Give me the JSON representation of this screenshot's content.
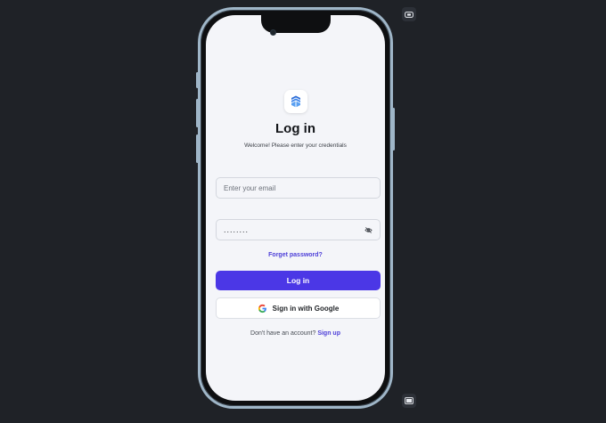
{
  "login": {
    "title": "Log in",
    "subtitle": "Welcome! Please enter your credentials",
    "email_placeholder": "Enter your email",
    "password_value": "........",
    "forgot_label": "Forget password?",
    "login_button_label": "Log in",
    "google_button_label": "Sign in with Google",
    "signup_prompt": "Don't have an account?",
    "signup_link": "Sign up"
  },
  "colors": {
    "accent": "#4b37e6",
    "link": "#4d3fd8",
    "background": "#1f2227",
    "screen": "#f4f5f9",
    "frame": "#9fb6c8"
  },
  "icons": {
    "logo": "brand-logo-icon",
    "password_toggle": "eye-off-icon",
    "google": "google-icon",
    "toolbar_top": "rotate-device-icon",
    "toolbar_bottom": "device-frame-icon"
  }
}
